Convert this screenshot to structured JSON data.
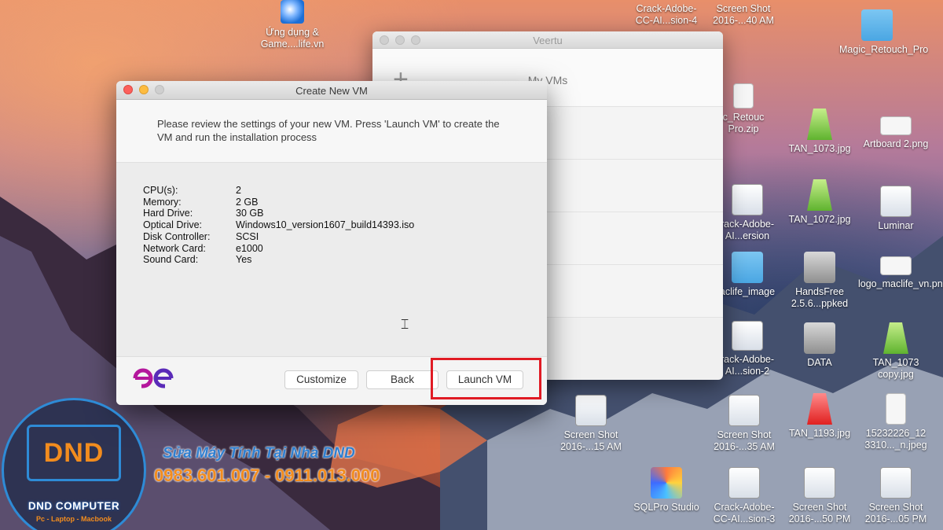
{
  "desktop_icons": [
    {
      "label": "Ứng dụng & Game....life.vn",
      "icon": "webloc-icon"
    },
    {
      "label": "Crack-Adobe-CC-AI...sion-4",
      "icon": "file-icon"
    },
    {
      "label": "Screen Shot 2016-...40 AM",
      "icon": "screenshot-icon"
    },
    {
      "label": "Magic_Retouch_Pro",
      "icon": "folder-icon"
    },
    {
      "label": "c_Retouc Pro.zip",
      "icon": "zip-icon"
    },
    {
      "label": "TAN_1073.jpg",
      "icon": "image-icon"
    },
    {
      "label": "Artboard 2.png",
      "icon": "image-icon"
    },
    {
      "label": "rack-Adobe-AI...ersion",
      "icon": "file-icon"
    },
    {
      "label": "TAN_1072.jpg",
      "icon": "image-icon"
    },
    {
      "label": "Luminar",
      "icon": "image-icon"
    },
    {
      "label": "aclife_image",
      "icon": "folder-icon"
    },
    {
      "label": "HandsFree 2.5.6...ppked",
      "icon": "app-icon"
    },
    {
      "label": "logo_maclife_vn.png",
      "icon": "image-icon"
    },
    {
      "label": "rack-Adobe-AI...sion-2",
      "icon": "file-icon"
    },
    {
      "label": "DATA",
      "icon": "drive-icon"
    },
    {
      "label": "TAN_1073 copy.jpg",
      "icon": "image-icon"
    },
    {
      "label": "Screen Shot 2016-...15 AM",
      "icon": "screenshot-icon"
    },
    {
      "label": "Screen Shot 2016-...35 AM",
      "icon": "screenshot-icon"
    },
    {
      "label": "TAN_1193.jpg",
      "icon": "image-icon"
    },
    {
      "label": "15232226_12 3310..._n.jpeg",
      "icon": "image-icon"
    },
    {
      "label": "SQLPro Studio",
      "icon": "sqlpro-icon"
    },
    {
      "label": "Crack-Adobe-CC-AI...sion-3",
      "icon": "file-icon"
    },
    {
      "label": "Screen Shot 2016-...50 PM",
      "icon": "screenshot-icon"
    },
    {
      "label": "Screen Shot 2016-...05 PM",
      "icon": "screenshot-icon"
    }
  ],
  "veertu": {
    "title": "Veertu",
    "add_label": "+",
    "list_title": "My VMs"
  },
  "dialog": {
    "title": "Create New VM",
    "intro": "Please review the settings of your new VM. Press 'Launch VM' to create the VM and run the installation process",
    "specs": [
      {
        "key": "CPU(s):",
        "value": "2"
      },
      {
        "key": "Memory:",
        "value": "2 GB"
      },
      {
        "key": "Hard Drive:",
        "value": "30 GB"
      },
      {
        "key": "Optical Drive:",
        "value": "Windows10_version1607_build14393.iso"
      },
      {
        "key": "Disk Controller:",
        "value": "SCSI"
      },
      {
        "key": "Network Card:",
        "value": "e1000"
      },
      {
        "key": "Sound Card:",
        "value": "Yes"
      }
    ],
    "buttons": {
      "customize": "Customize",
      "back": "Back",
      "launch": "Launch VM"
    }
  },
  "watermark": {
    "logo_text": "DND",
    "company": "DND COMPUTER",
    "tagline": "Pc - Laptop - Macbook",
    "line1": "Sửa Máy Tính Tại Nhà DND",
    "line2": "0983.601.007 - 0911.013.000"
  },
  "colors": {
    "highlight": "#e01b24",
    "veertu_logo": "#b4179c",
    "watermark_blue": "#2e8bd6",
    "watermark_orange": "#f28c1e"
  }
}
